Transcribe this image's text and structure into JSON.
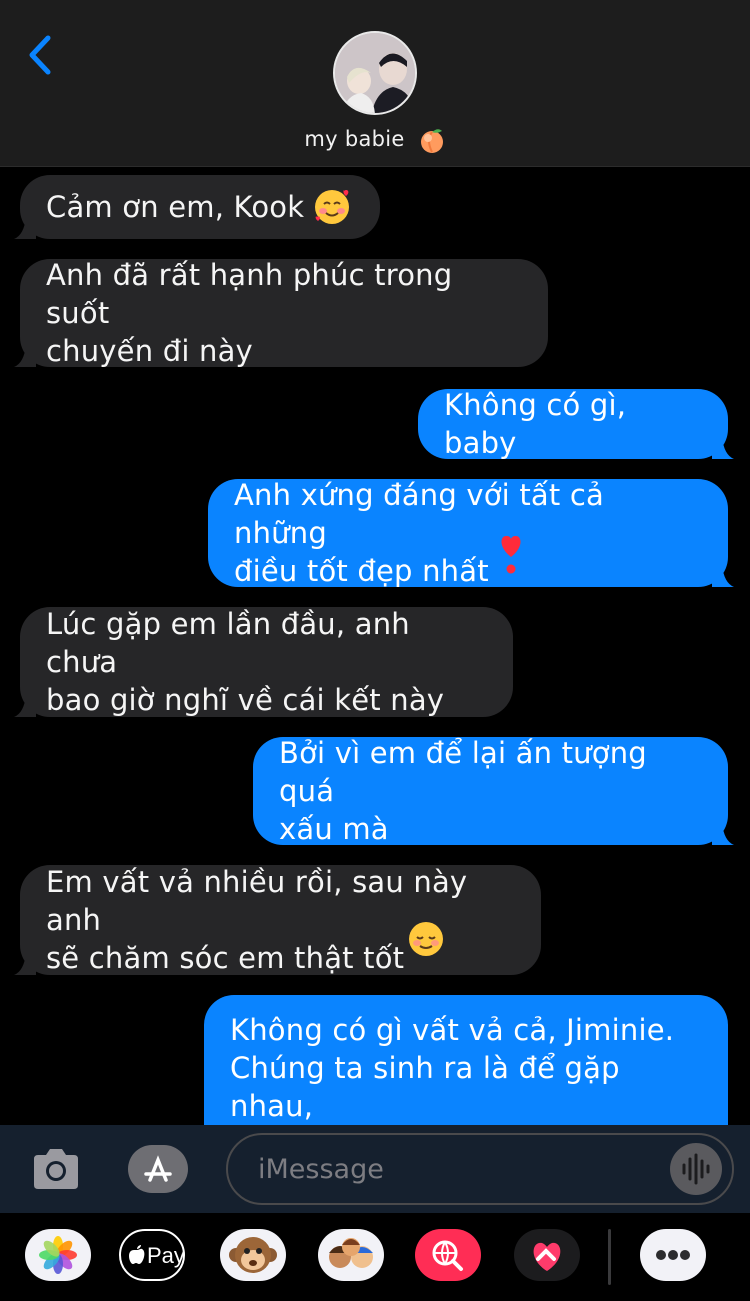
{
  "header": {
    "contact_name": "my babie",
    "contact_emoji": "peach-emoji"
  },
  "messages": [
    {
      "from": "them",
      "text": "Cảm ơn em, Kook",
      "emoji": "smiling-face-with-hearts"
    },
    {
      "from": "them",
      "text": "Anh đã rất hạnh phúc trong suốt\nchuyến đi này"
    },
    {
      "from": "me",
      "text": "Không có gì, baby"
    },
    {
      "from": "me",
      "text": "Anh xứng đáng với tất cả những\nđiều tốt đẹp nhất",
      "emoji": "heart-exclamation"
    },
    {
      "from": "them",
      "text": "Lúc gặp em lần đầu, anh chưa\nbao giờ nghĩ về cái kết này"
    },
    {
      "from": "me",
      "text": "Bởi vì em để lại ấn tượng quá\nxấu mà"
    },
    {
      "from": "them",
      "text": "Em vất vả nhiều rồi, sau này anh\nsẽ chăm sóc em thật tốt",
      "emoji": "smiling-face"
    },
    {
      "from": "me",
      "text": "Không có gì vất vả cả, Jiminie.\nChúng ta sinh ra là để gặp nhau,\nbên cạnh nhau và cùng nhau"
    }
  ],
  "input": {
    "placeholder": "iMessage"
  },
  "apps": {
    "apple_pay_label": "Pay"
  },
  "colors": {
    "incoming_bubble": "#262628",
    "outgoing_bubble": "#0a84ff",
    "accent": "#0a84ff"
  }
}
